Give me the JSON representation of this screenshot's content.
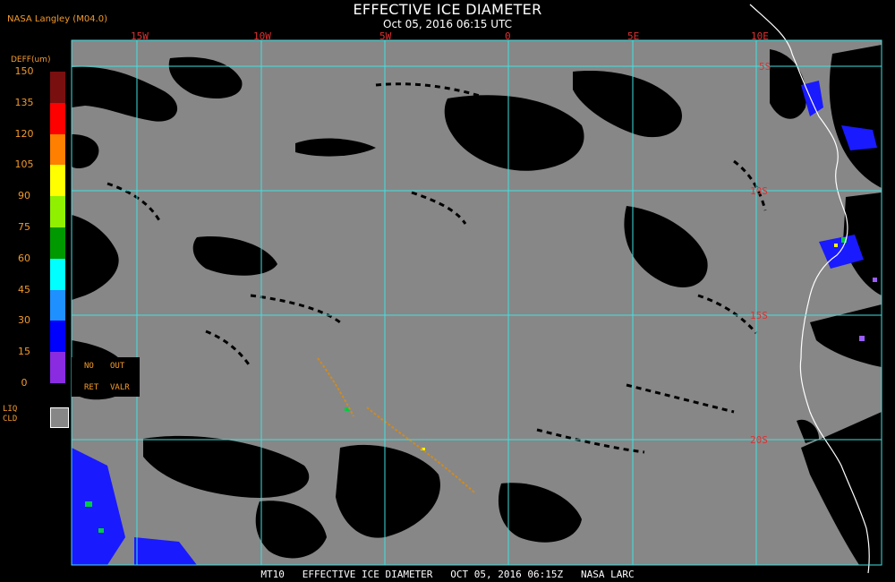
{
  "header": {
    "credit": "NASA Langley (M04.0)",
    "title": "EFFECTIVE ICE DIAMETER",
    "subtitle": "Oct 05, 2016 06:15 UTC"
  },
  "map": {
    "projection": "lat-lon",
    "lon_labels": [
      "15W",
      "10W",
      "5W",
      "0",
      "5E",
      "10E"
    ],
    "lat_labels": [
      "5S",
      "10S",
      "15S",
      "20S"
    ],
    "background_color": "#878787",
    "clear_color": "#000000",
    "coast_color": "#ffffff",
    "grid_color": "#40e0e0",
    "label_color": "#e03030"
  },
  "colorbar": {
    "units_label": "DEFF(um)",
    "ticks": [
      "150",
      "135",
      "120",
      "105",
      "90",
      "75",
      "60",
      "45",
      "30",
      "15",
      "0"
    ],
    "colors": [
      "#7a0f0f",
      "#ff0000",
      "#ff7f00",
      "#ffff00",
      "#8ff000",
      "#009900",
      "#00ffff",
      "#1e90ff",
      "#0000ff",
      "#8a2be2"
    ],
    "no_ret_label_1": "NO",
    "no_ret_label_2": "RET",
    "out_valr_label_1": "OUT",
    "out_valr_label_2": "VALR",
    "liq_label_1": "LIQ",
    "liq_label_2": "CLD"
  },
  "footer": {
    "text": "MT10   EFFECTIVE ICE DIAMETER   OCT 05, 2016 06:15Z   NASA LARC"
  }
}
